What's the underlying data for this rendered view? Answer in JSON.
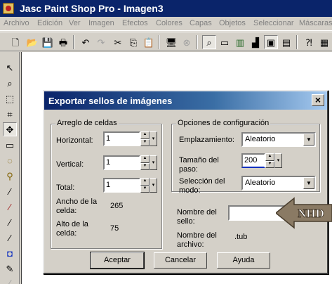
{
  "window": {
    "title": "Jasc Paint Shop Pro - Imagen3"
  },
  "menubar": {
    "items": [
      "Archivo",
      "Edición",
      "Ver",
      "Imagen",
      "Efectos",
      "Colores",
      "Capas",
      "Objetos",
      "Seleccionar",
      "Máscaras"
    ]
  },
  "toolbar": {
    "icons": [
      "new-icon",
      "open-icon",
      "save-icon",
      "print-icon",
      "undo-icon",
      "redo-icon",
      "cut-icon",
      "copy-icon",
      "paste-icon",
      "monitor-icon",
      "browse-icon",
      "zoom-icon",
      "toolbar-toggle-icon",
      "color-palette-icon",
      "histogram-icon",
      "overview-icon",
      "tool-options-icon",
      "help-context-icon",
      "layers-icon"
    ]
  },
  "toolbox": {
    "icons": [
      "arrow-icon",
      "zoom-icon",
      "deformation-icon",
      "crop-icon",
      "move-icon",
      "selection-icon",
      "freehand-icon",
      "magic-wand-icon",
      "dropper-icon",
      "brush-icon",
      "clone-icon",
      "color-replacer-icon",
      "retouch-icon",
      "scratch-icon",
      "eraser-icon"
    ]
  },
  "dialog": {
    "title": "Exportar sellos de imágenes",
    "close_label": "×",
    "grid_group": {
      "legend": "Arreglo de celdas",
      "horizontal_label": "Horizontal:",
      "horizontal_value": "1",
      "vertical_label": "Vertical:",
      "vertical_value": "1",
      "total_label": "Total:",
      "total_value": "1",
      "cell_width_label_1": "Ancho de la",
      "cell_width_label_2": "celda:",
      "cell_width_value": "265",
      "cell_height_label_1": "Alto de la",
      "cell_height_label_2": "celda:",
      "cell_height_value": "75"
    },
    "config_group": {
      "legend": "Opciones de configuración",
      "placement_label": "Emplazamiento:",
      "placement_value": "Aleatorio",
      "step_label_1": "Tamaño del",
      "step_label_2": "paso:",
      "step_value": "200",
      "mode_label_1": "Selección del",
      "mode_label_2": "modo:",
      "mode_value": "Aleatorio"
    },
    "stamp_name_label_1": "Nombre del",
    "stamp_name_label_2": "sello:",
    "stamp_name_value": "",
    "file_name_label_1": "Nombre del",
    "file_name_label_2": "archivo:",
    "file_name_value": ".tub",
    "buttons": {
      "ok": "Aceptar",
      "cancel": "Cancelar",
      "help": "Ayuda"
    }
  },
  "watermark": {
    "text": "NHD"
  },
  "colors": {
    "title_bar": "#0a246a",
    "face": "#d4d0c8",
    "watermark": "#8a7a64"
  }
}
